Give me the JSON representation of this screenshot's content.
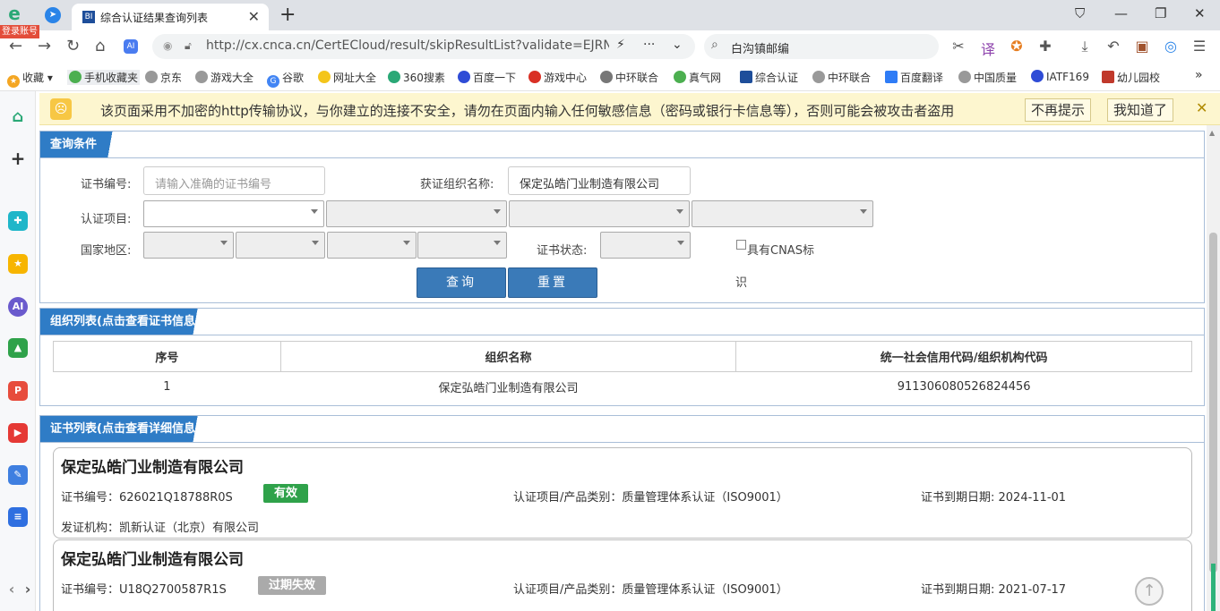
{
  "browser": {
    "login_badge": "登录账号",
    "tab_title": "综合认证结果查询列表",
    "tab_favicon": "BI",
    "url": "http://cx.cnca.cn/CertECloud/result/skipResultList?validate=EJRN&",
    "search_text": "白沟镇邮编"
  },
  "bookmarks": [
    {
      "label": "收藏",
      "color": "#f4a623"
    },
    {
      "label": "手机收藏夹",
      "color": "#4caf50"
    },
    {
      "label": "京东",
      "color": "#999999"
    },
    {
      "label": "游戏大全",
      "color": "#999999"
    },
    {
      "label": "谷歌",
      "color": "#4285f4"
    },
    {
      "label": "网址大全",
      "color": "#f4c51b"
    },
    {
      "label": "360搜素",
      "color": "#2aa876"
    },
    {
      "label": "百度一下",
      "color": "#2f4cd6"
    },
    {
      "label": "游戏中心",
      "color": "#d93025"
    },
    {
      "label": "中环联合",
      "color": "#777777"
    },
    {
      "label": "真气网",
      "color": "#4caf50"
    },
    {
      "label": "综合认证",
      "color": "#1e4e9a"
    },
    {
      "label": "中环联合",
      "color": "#999999"
    },
    {
      "label": "百度翻译",
      "color": "#2f7cf6"
    },
    {
      "label": "中国质量",
      "color": "#999999"
    },
    {
      "label": "IATF169",
      "color": "#2f4cd6"
    },
    {
      "label": "幼儿园校",
      "color": "#c0392b"
    }
  ],
  "banner": {
    "text": "该页面采用不加密的http传输协议，与你建立的连接不安全，请勿在页面内输入任何敏感信息（密码或银行卡信息等），否则可能会被攻击者盗用",
    "dont_remind": "不再提示",
    "got_it": "我知道了"
  },
  "query": {
    "header": "查询条件",
    "cert_no_label": "证书编号:",
    "cert_no_placeholder": "请输入准确的证书编号",
    "org_name_label": "获证组织名称:",
    "org_name_value": "保定弘皓门业制造有限公司",
    "project_label": "认证项目:",
    "region_label": "国家地区:",
    "status_label": "证书状态:",
    "cnas_label": "具有CNAS标",
    "cnas_label_wrap": "识",
    "search_button": "查询",
    "reset_button": "重置"
  },
  "org_list": {
    "header": "组织列表(点击查看证书信息)",
    "columns": [
      "序号",
      "组织名称",
      "统一社会信用代码/组织机构代码"
    ],
    "rows": [
      [
        "1",
        "保定弘皓门业制造有限公司",
        "911306080526824456"
      ]
    ]
  },
  "cert_list": {
    "header": "证书列表(点击查看详细信息)",
    "cards": [
      {
        "org": "保定弘皓门业制造有限公司",
        "cert_no": "证书编号：626021Q18788R0S",
        "status": "有效",
        "status_color": "#2fa24a",
        "project": "认证项目/产品类别：质量管理体系认证（ISO9001）",
        "expiry": "证书到期日期: 2024-11-01",
        "issuer": "发证机构：凯新认证（北京）有限公司"
      },
      {
        "org": "保定弘皓门业制造有限公司",
        "cert_no": "证书编号：U18Q2700587R1S",
        "status": "过期失效",
        "status_color": "#aaaaaa",
        "project": "认证项目/产品类别：质量管理体系认证（ISO9001）",
        "expiry": "证书到期日期: 2021-07-17",
        "issuer": ""
      }
    ]
  }
}
